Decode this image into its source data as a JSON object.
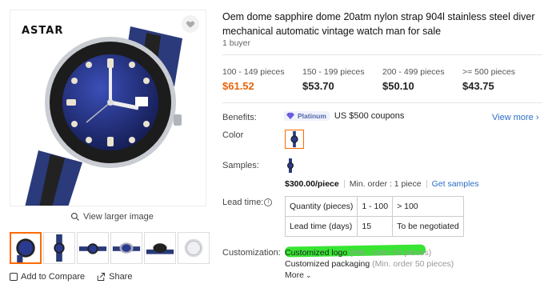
{
  "gallery": {
    "brand": "ASTAR",
    "view_larger": "View larger image",
    "thumbnail_count": 6,
    "active_thumbnail": 1
  },
  "actions": {
    "compare": "Add to Compare",
    "share": "Share"
  },
  "product": {
    "title": "Oem dome sapphire dome 20atm nylon strap 904l stainless steel diver mechanical automatic vintage watch man for sale",
    "buyers": "1 buyer"
  },
  "price_tiers": [
    {
      "qty": "100 - 149 pieces",
      "price": "$61.52"
    },
    {
      "qty": "150 - 199 pieces",
      "price": "$53.70"
    },
    {
      "qty": "200 - 499 pieces",
      "price": "$50.10"
    },
    {
      "qty": ">= 500 pieces",
      "price": "$43.75"
    }
  ],
  "benefits": {
    "label": "Benefits:",
    "badge": "Platinum",
    "text": "US $500 coupons",
    "view_more": "View more"
  },
  "color": {
    "label": "Color"
  },
  "samples": {
    "label": "Samples:",
    "price": "$300.00/piece",
    "min_order": "Min. order : 1 piece",
    "link": "Get samples"
  },
  "lead_time": {
    "label": "Lead time:",
    "rows": [
      [
        "Quantity (pieces)",
        "1 - 100",
        "> 100"
      ],
      [
        "Lead time (days)",
        "15",
        "To be negotiated"
      ]
    ]
  },
  "customization": {
    "label": "Customization:",
    "items": [
      {
        "name": "Customized logo",
        "min": "(Min. order 50 pieces)"
      },
      {
        "name": "Customized packaging",
        "min": "(Min. order 50 pieces)"
      }
    ],
    "more": "More"
  },
  "colors": {
    "accent": "#e8640c",
    "link": "#2a6ec4",
    "highlight": "#22e21c"
  }
}
